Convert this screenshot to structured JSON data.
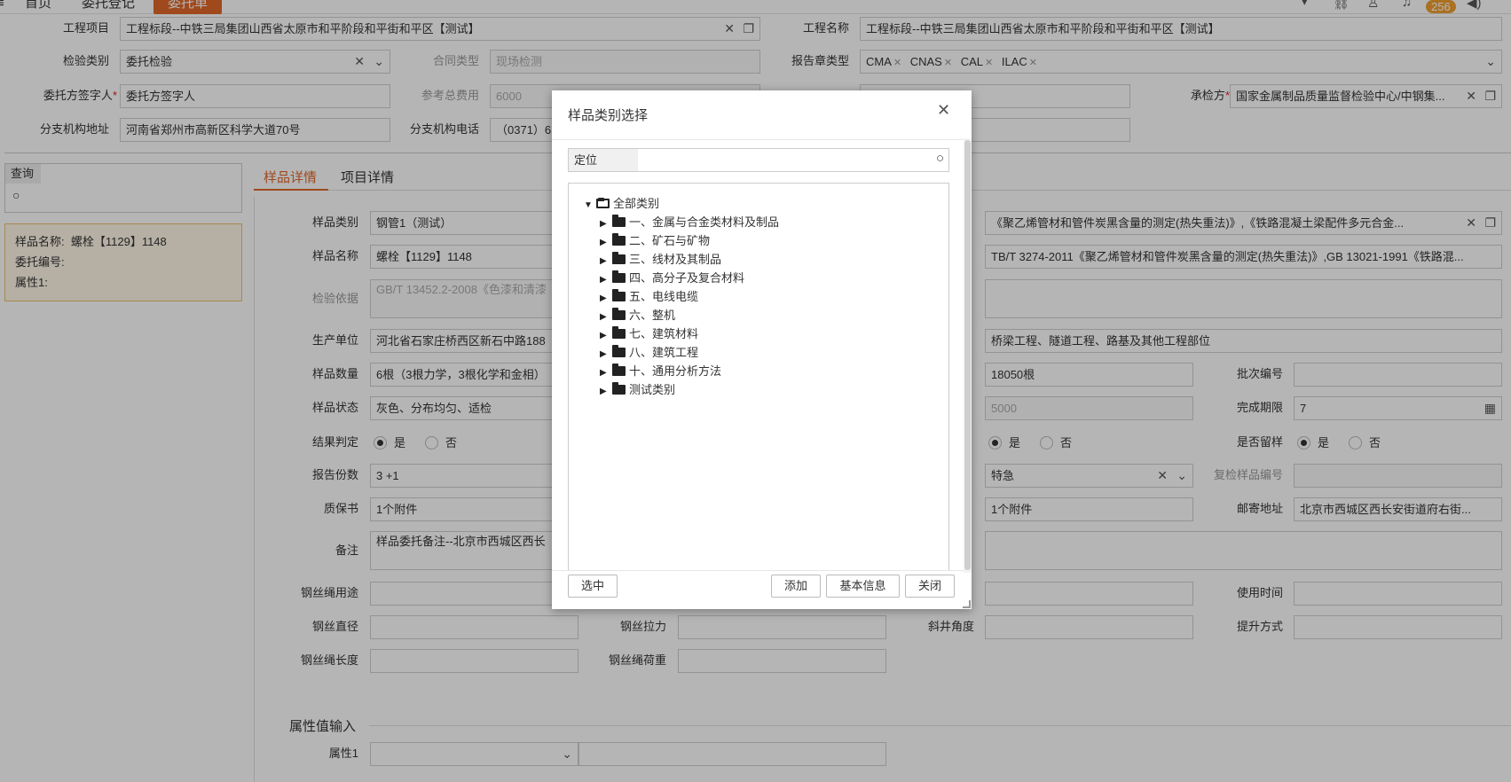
{
  "topbar": {
    "tabs": [
      "首页",
      "委托登记",
      "委托单"
    ],
    "badge": "256"
  },
  "form": {
    "project_label": "工程项目",
    "project_value": "工程标段--中铁三局集团山西省太原市和平阶段和平街和平区【测试】",
    "project_name_label": "工程名称",
    "project_name_value": "工程标段--中铁三局集团山西省太原市和平阶段和平街和平区【测试】",
    "insp_type_label": "检验类别",
    "insp_type_value": "委托检验",
    "contract_type_label": "合同类型",
    "contract_type_value": "现场检测",
    "report_seal_label": "报告章类型",
    "report_seals": [
      "CMA",
      "CNAS",
      "CAL",
      "ILAC"
    ],
    "client_signer_label": "委托方签字人",
    "client_signer_value": "委托方签字人",
    "ref_fee_label": "参考总费用",
    "ref_fee_value": "6000",
    "inspector_label": "承检方",
    "inspector_value": "国家金属制品质量监督检验中心/中钢集...",
    "branch_addr_label": "分支机构地址",
    "branch_addr_value": "河南省郑州市高新区科学大道70号",
    "branch_phone_label": "分支机构电话",
    "branch_phone_value": "（0371）6"
  },
  "sidebar": {
    "query_label": "查询",
    "card": {
      "name_label": "样品名称:",
      "name_value": "螺栓【1129】1148",
      "no_label": "委托编号:",
      "attr_label": "属性1:"
    }
  },
  "tabs": {
    "sample": "样品详情",
    "project": "项目详情"
  },
  "detail": {
    "sample_type_label": "样品类别",
    "sample_type_value": "钢管1（测试）",
    "right1_value": "《聚乙烯管材和管件炭黑含量的测定(热失重法)》,《铁路混凝土梁配件多元合金...",
    "sample_name_label": "样品名称",
    "sample_name_value": "螺栓【1129】1148",
    "right2_value": "TB/T 3274-2011《聚乙烯管材和管件炭黑含量的测定(热失重法)》,GB 13021-1991《铁路混...",
    "basis_label": "检验依据",
    "basis_value": "GB/T 13452.2-2008《色漆和清漆",
    "producer_label": "生产单位",
    "producer_value": "河北省石家庄桥西区新石中路188",
    "usage_part_value": "桥梁工程、隧道工程、路基及其他工程部位",
    "qty_label": "样品数量",
    "qty_value": "6根（3根力学，3根化学和金相）",
    "represent_value": "18050根",
    "batch_label": "批次编号",
    "state_label": "样品状态",
    "state_value": "灰色、分布均匀、适检",
    "fee_value": "5000",
    "deadline_label": "完成期限",
    "deadline_value": "7",
    "judge_label": "结果判定",
    "yes": "是",
    "no": "否",
    "keep_label": "是否留样",
    "copies_label": "报告份数",
    "copies_value": "3  +1",
    "urgent_value": "特急",
    "recheck_label": "复检样品编号",
    "warranty_label": "质保书",
    "warranty_value": "1个附件",
    "right_warranty_value": "1个附件",
    "mail_label": "邮寄地址",
    "mail_value": "北京市西城区西长安街道府右街...",
    "remark_label": "备注",
    "remark_value": "样品委托备注--北京市西城区西长",
    "rope_use_label": "钢丝绳用途",
    "use_time_label": "使用时间",
    "rope_dia_label": "钢丝直径",
    "rope_tension_label": "钢丝拉力",
    "incline_label": "斜井角度",
    "lift_label": "提升方式",
    "rope_len_label": "钢丝绳长度",
    "rope_load_label": "钢丝绳荷重",
    "attr_section": "属性值输入",
    "attr1_label": "属性1"
  },
  "dialog": {
    "title": "样品类别选择",
    "locate_label": "定位",
    "root": "全部类别",
    "items": [
      "一、金属与合金类材料及制品",
      "二、矿石与矿物",
      "三、线材及其制品",
      "四、高分子及复合材料",
      "五、电线电缆",
      "六、整机",
      "七、建筑材料",
      "八、建筑工程",
      "十、通用分析方法",
      "测试类别"
    ],
    "btn_select": "选中",
    "btn_add": "添加",
    "btn_info": "基本信息",
    "btn_close": "关闭"
  }
}
